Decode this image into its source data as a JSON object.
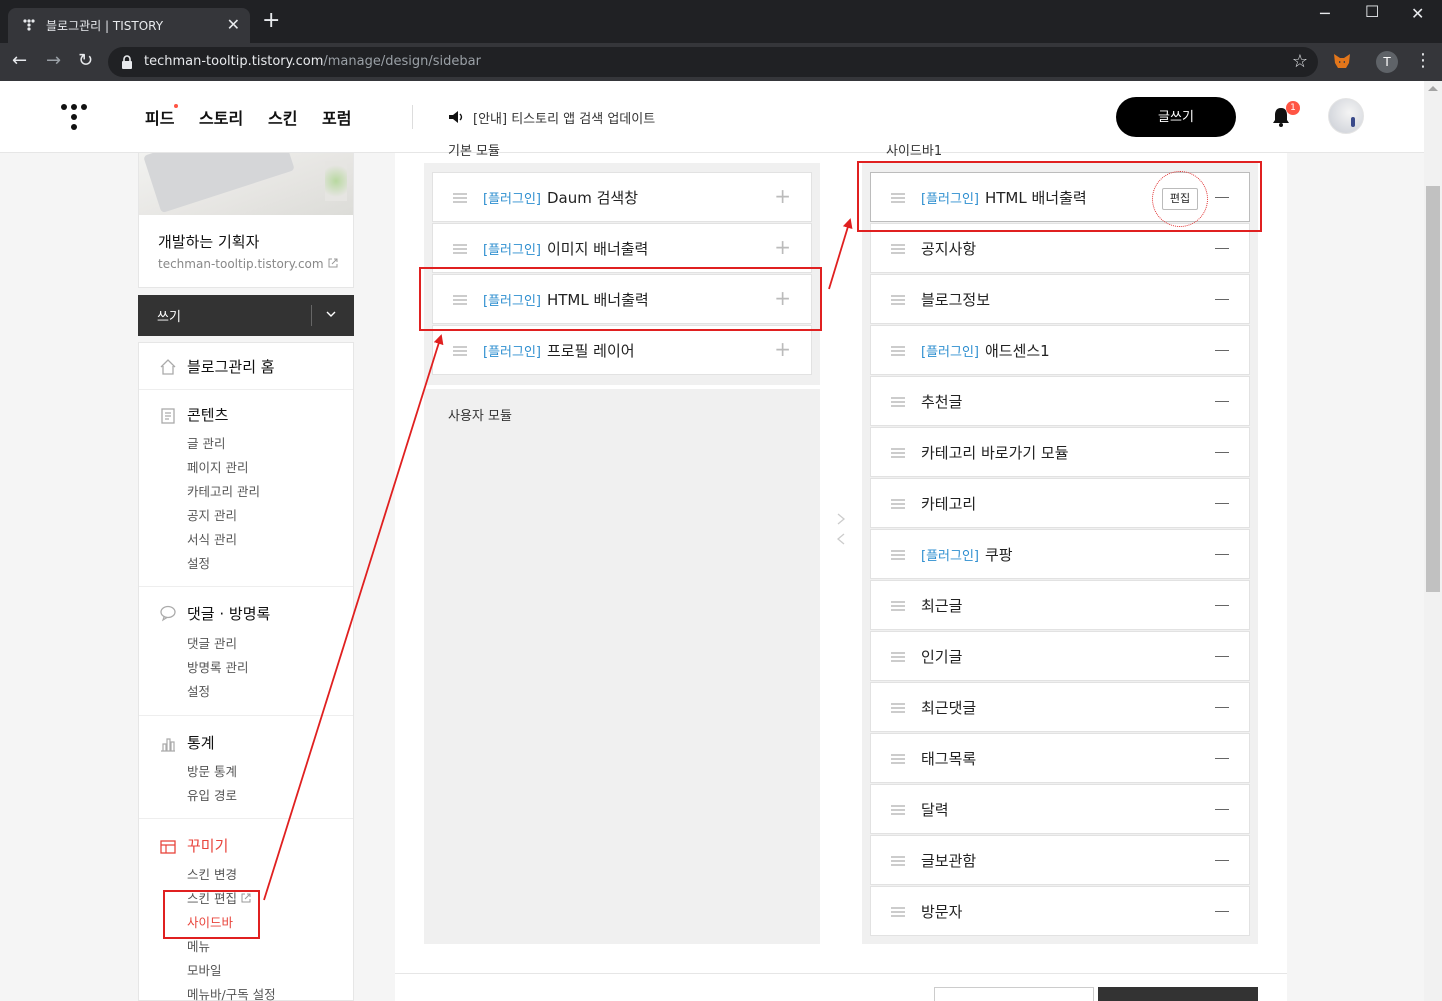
{
  "browser": {
    "tab_title": "블로그관리 | TISTORY",
    "url_host": "techman-tooltip.tistory.com",
    "url_path": "/manage/design/sidebar",
    "profile_initial": "T"
  },
  "header": {
    "nav": [
      "피드",
      "스토리",
      "스킨",
      "포럼"
    ],
    "notice": "[안내] 티스토리 앱 검색 업데이트",
    "write_label": "글쓰기",
    "notification_count": "1"
  },
  "blog": {
    "name": "개발하는 기획자",
    "url": "techman-tooltip.tistory.com",
    "write_menu": "쓰기"
  },
  "menu": {
    "home": "블로그관리 홈",
    "content": {
      "title": "콘텐츠",
      "items": [
        "글 관리",
        "페이지 관리",
        "카테고리 관리",
        "공지 관리",
        "서식 관리",
        "설정"
      ]
    },
    "comments": {
      "title": "댓글 · 방명록",
      "items": [
        "댓글 관리",
        "방명록 관리",
        "설정"
      ]
    },
    "stats": {
      "title": "통계",
      "items": [
        "방문 통계",
        "유입 경로"
      ]
    },
    "design": {
      "title": "꾸미기",
      "items": [
        "스킨 변경",
        "스킨 편집",
        "사이드바",
        "메뉴",
        "모바일",
        "메뉴바/구독 설정"
      ]
    }
  },
  "modules": {
    "basic_label": "기본 모듈",
    "plugin_tag": "[플러그인]",
    "basic": [
      {
        "plugin": true,
        "name": "Daum 검색창"
      },
      {
        "plugin": true,
        "name": "이미지 배너출력"
      },
      {
        "plugin": true,
        "name": "HTML 배너출력"
      },
      {
        "plugin": true,
        "name": "프로필 레이어"
      }
    ],
    "user_label": "사용자 모듈",
    "sidebar_label": "사이드바1",
    "sidebar": [
      {
        "plugin": true,
        "name": "HTML 배너출력"
      },
      {
        "plugin": false,
        "name": "공지사항"
      },
      {
        "plugin": false,
        "name": "블로그정보"
      },
      {
        "plugin": true,
        "name": "애드센스1"
      },
      {
        "plugin": false,
        "name": "추천글"
      },
      {
        "plugin": false,
        "name": "카테고리 바로가기 모듈"
      },
      {
        "plugin": false,
        "name": "카테고리"
      },
      {
        "plugin": true,
        "name": "쿠팡"
      },
      {
        "plugin": false,
        "name": "최근글"
      },
      {
        "plugin": false,
        "name": "인기글"
      },
      {
        "plugin": false,
        "name": "최근댓글"
      },
      {
        "plugin": false,
        "name": "태그목록"
      },
      {
        "plugin": false,
        "name": "달력"
      },
      {
        "plugin": false,
        "name": "글보관함"
      },
      {
        "plugin": false,
        "name": "방문자"
      }
    ],
    "edit_label": "편집"
  },
  "colors": {
    "accent": "#e8453c",
    "plugin_tag": "#2f8fd0",
    "annotation": "#e02020"
  }
}
